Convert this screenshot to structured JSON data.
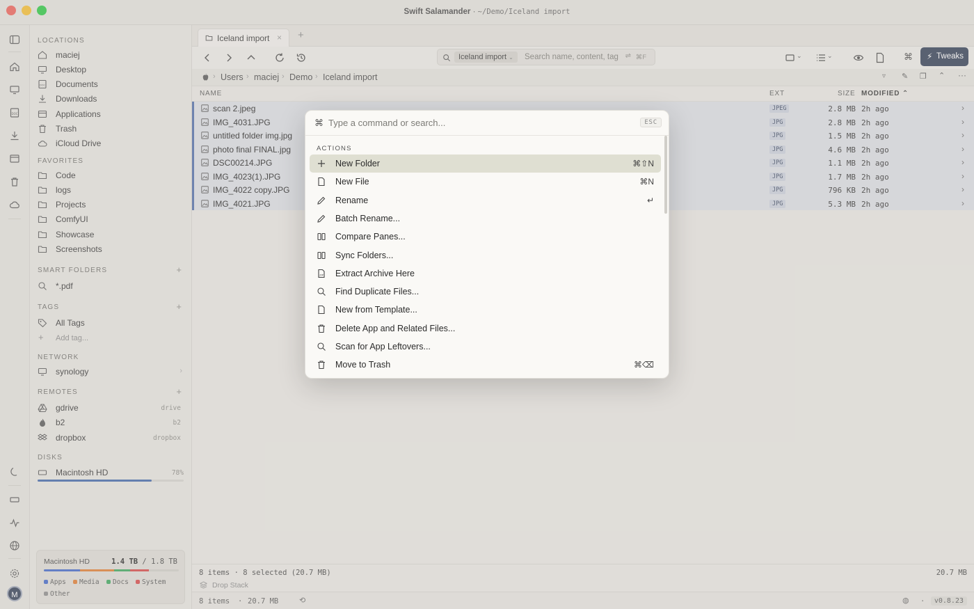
{
  "window": {
    "app_name": "Swift Salamander",
    "path": "~/Demo/Iceland import",
    "separator": "·"
  },
  "sidebar": {
    "locations_header": "LOCATIONS",
    "locations": [
      {
        "label": "maciej",
        "icon": "home-icon"
      },
      {
        "label": "Desktop",
        "icon": "desktop-icon"
      },
      {
        "label": "Documents",
        "icon": "documents-icon"
      },
      {
        "label": "Downloads",
        "icon": "downloads-icon"
      },
      {
        "label": "Applications",
        "icon": "applications-icon"
      },
      {
        "label": "Trash",
        "icon": "trash-icon"
      },
      {
        "label": "iCloud Drive",
        "icon": "cloud-icon"
      }
    ],
    "favorites_header": "FAVORITES",
    "favorites": [
      "Code",
      "logs",
      "Projects",
      "ComfyUI",
      "Showcase",
      "Screenshots"
    ],
    "smart_header": "SMART FOLDERS",
    "smart": [
      "*.pdf"
    ],
    "tags_header": "TAGS",
    "tags_all": "All Tags",
    "tags_add": "Add tag...",
    "network_header": "NETWORK",
    "network": [
      "synology"
    ],
    "remotes_header": "REMOTES",
    "remotes": [
      {
        "label": "gdrive",
        "tag": "drive"
      },
      {
        "label": "b2",
        "tag": "b2"
      },
      {
        "label": "dropbox",
        "tag": "dropbox"
      }
    ],
    "disks_header": "DISKS",
    "disk": {
      "label": "Macintosh HD",
      "percent_label": "78%",
      "percent": 78
    },
    "storage": {
      "title": "Macintosh HD",
      "used": "1.4",
      "used_unit": "TB",
      "total": "/ 1.8 TB",
      "legend": [
        {
          "label": "Apps",
          "color": "#3e64c8"
        },
        {
          "label": "Media",
          "color": "#e07a2e"
        },
        {
          "label": "Docs",
          "color": "#3aa55b"
        },
        {
          "label": "System",
          "color": "#d64545"
        },
        {
          "label": "Other",
          "color": "#8a8a8a"
        }
      ]
    }
  },
  "tab": {
    "label": "Iceland import"
  },
  "toolbar": {
    "search_scope": "Iceland import",
    "search_placeholder": "Search name, content, tag",
    "search_shortcut": "⌘F",
    "tweaks_label": "Tweaks",
    "accent": "#2f3b52"
  },
  "breadcrumbs": [
    "Users",
    "maciej",
    "Demo",
    "Iceland import"
  ],
  "columns": {
    "name": "NAME",
    "ext": "EXT",
    "size": "SIZE",
    "modified": "MODIFIED"
  },
  "files": [
    {
      "name": "scan 2.jpeg",
      "ext": "JPEG",
      "size": "2.8 MB",
      "modified": "2h ago"
    },
    {
      "name": "IMG_4031.JPG",
      "ext": "JPG",
      "size": "2.8 MB",
      "modified": "2h ago"
    },
    {
      "name": "untitled folder img.jpg",
      "ext": "JPG",
      "size": "1.5 MB",
      "modified": "2h ago"
    },
    {
      "name": "photo final FINAL.jpg",
      "ext": "JPG",
      "size": "4.6 MB",
      "modified": "2h ago"
    },
    {
      "name": "DSC00214.JPG",
      "ext": "JPG",
      "size": "1.1 MB",
      "modified": "2h ago"
    },
    {
      "name": "IMG_4023(1).JPG",
      "ext": "JPG",
      "size": "1.7 MB",
      "modified": "2h ago"
    },
    {
      "name": "IMG_4022 copy.JPG",
      "ext": "JPG",
      "size": "796 KB",
      "modified": "2h ago"
    },
    {
      "name": "IMG_4021.JPG",
      "ext": "JPG",
      "size": "5.3 MB",
      "modified": "2h ago"
    }
  ],
  "status": {
    "summary": "8 items · 8 selected (20.7 MB)",
    "total_right": "20.7 MB",
    "drop_stack": "Drop Stack",
    "bottom_items": "8 items",
    "bottom_size": "20.7 MB",
    "bottom_sep": "·",
    "version": "v0.8.23"
  },
  "palette": {
    "placeholder": "Type a command or search...",
    "esc": "ESC",
    "section": "ACTIONS",
    "items": [
      {
        "label": "New Folder",
        "shortcut": "⌘⇧N",
        "icon": "plus-icon"
      },
      {
        "label": "New File",
        "shortcut": "⌘N",
        "icon": "file-icon"
      },
      {
        "label": "Rename",
        "shortcut": "↵",
        "icon": "pencil-icon"
      },
      {
        "label": "Batch Rename...",
        "shortcut": "",
        "icon": "pencil-icon"
      },
      {
        "label": "Compare Panes...",
        "shortcut": "",
        "icon": "columns-icon"
      },
      {
        "label": "Sync Folders...",
        "shortcut": "",
        "icon": "columns-icon"
      },
      {
        "label": "Extract Archive Here",
        "shortcut": "",
        "icon": "archive-icon"
      },
      {
        "label": "Find Duplicate Files...",
        "shortcut": "",
        "icon": "search-icon"
      },
      {
        "label": "New from Template...",
        "shortcut": "",
        "icon": "file-icon"
      },
      {
        "label": "Delete App and Related Files...",
        "shortcut": "",
        "icon": "trash-icon"
      },
      {
        "label": "Scan for App Leftovers...",
        "shortcut": "",
        "icon": "search-icon"
      },
      {
        "label": "Move to Trash",
        "shortcut": "⌘⌫",
        "icon": "trash-icon"
      }
    ]
  }
}
